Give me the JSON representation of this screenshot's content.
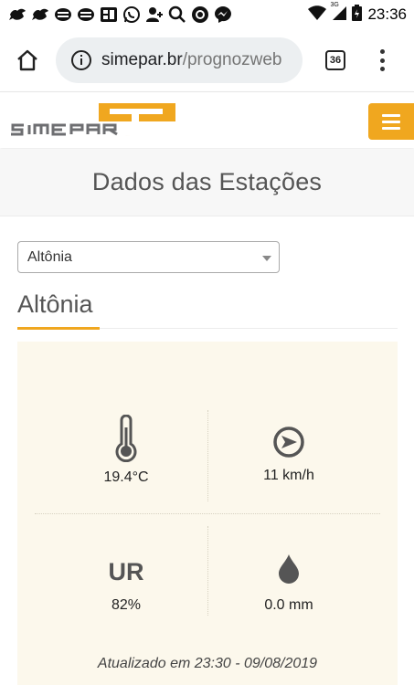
{
  "status_bar": {
    "time": "23:36",
    "network_label": "3G",
    "notification_icons": [
      "bird-icon",
      "bird-icon",
      "stack-icon",
      "stack-icon",
      "app-icon",
      "whatsapp-icon",
      "add-person-icon",
      "search-icon",
      "shield-icon",
      "messenger-icon"
    ]
  },
  "browser": {
    "url_domain": "simepar.br",
    "url_path": "/prognozweb",
    "tab_count": "36"
  },
  "site": {
    "logo_text": "SIMEPAR",
    "brand_color": "#f0a71f"
  },
  "page": {
    "title": "Dados das Estações"
  },
  "station_select": {
    "selected": "Altônia"
  },
  "station": {
    "name": "Altônia",
    "temperature": "19.4°C",
    "wind": "11 km/h",
    "humidity_label": "UR",
    "humidity": "82%",
    "rain": "0.0 mm",
    "updated": "Atualizado em 23:30 - 09/08/2019"
  }
}
